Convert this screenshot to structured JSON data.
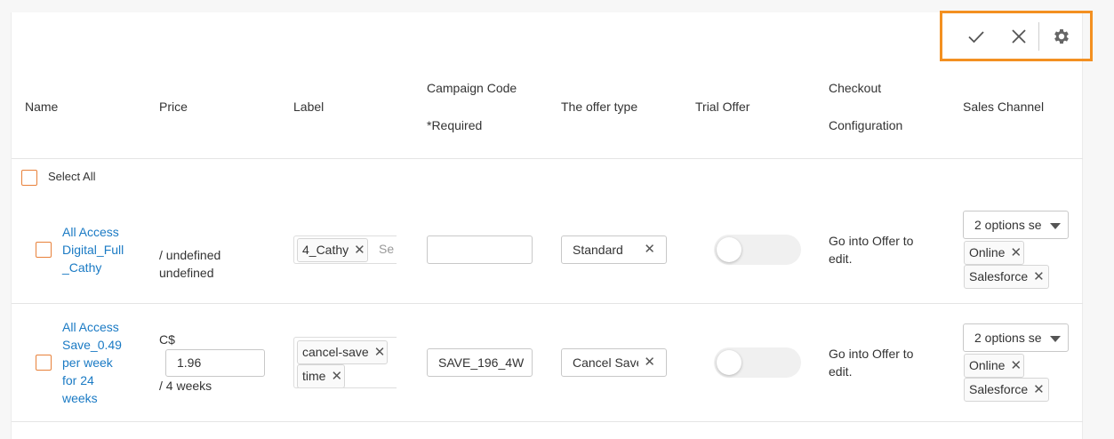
{
  "toolbar": {
    "confirm_icon": "check-icon",
    "cancel_icon": "close-icon",
    "settings_icon": "gear-icon",
    "highlight_color": "#f39021"
  },
  "columns": {
    "name": "Name",
    "price": "Price",
    "label": "Label",
    "campaign_code_line1": "Campaign Code",
    "campaign_code_line2": "*Required",
    "offer_type": "The offer type",
    "trial_offer": "Trial Offer",
    "checkout_line1": "Checkout",
    "checkout_line2": "Configuration",
    "sales_channel": "Sales Channel"
  },
  "select_all": {
    "label": "Select All"
  },
  "rows": [
    {
      "name_lines": [
        "All Access",
        "Digital_Full",
        "_Cathy"
      ],
      "price_lines": [
        "/ undefined",
        "undefined"
      ],
      "labels": [
        "4_Cathy"
      ],
      "label_search_placeholder": "Se",
      "campaign_code": "",
      "offer_type": "Standard",
      "trial_offer_enabled": false,
      "checkout_lines": [
        "Go into Offer to",
        "edit."
      ],
      "sales_channel_select": "2 options se",
      "sales_channels": [
        "Online",
        "Salesforce"
      ]
    },
    {
      "name_lines": [
        "All Access",
        "Save_0.49",
        "per week",
        "for 24",
        "weeks"
      ],
      "price_currency": "C$",
      "price_value": "1.96",
      "price_period": "/ 4 weeks",
      "labels": [
        "cancel-save",
        "time"
      ],
      "campaign_code": "SAVE_196_4W",
      "offer_type": "Cancel Save",
      "trial_offer_enabled": false,
      "checkout_lines": [
        "Go into Offer to",
        "edit."
      ],
      "sales_channel_select": "2 options se",
      "sales_channels": [
        "Online",
        "Salesforce"
      ]
    }
  ]
}
